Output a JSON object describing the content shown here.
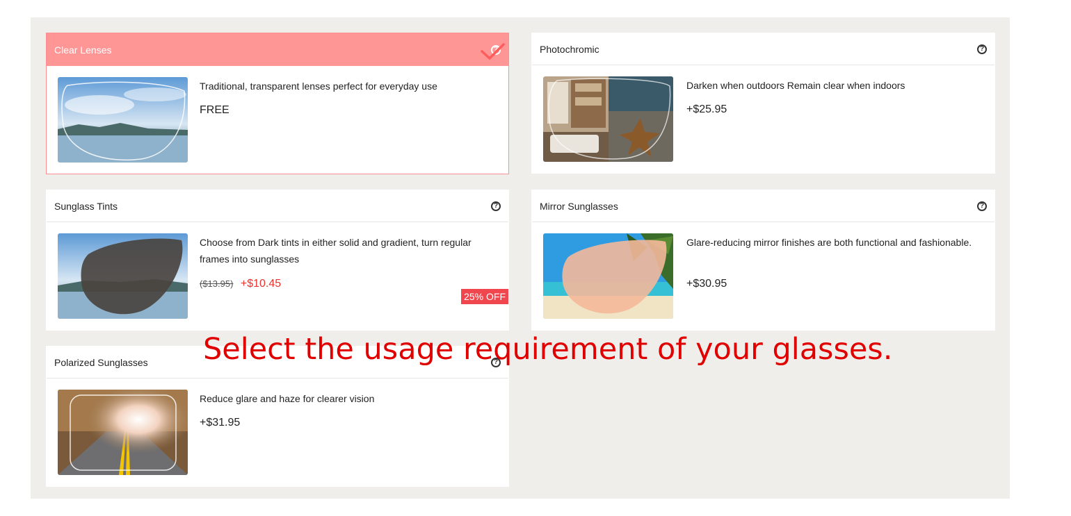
{
  "options": [
    {
      "title": "Clear Lenses",
      "description": "Traditional, transparent lenses perfect for everyday use",
      "price": "FREE",
      "selected": true,
      "icon": "help-icon"
    },
    {
      "title": "Photochromic",
      "description": "Darken when outdoors Remain clear when indoors",
      "price": "+$25.95",
      "icon": "help-icon"
    },
    {
      "title": "Sunglass Tints",
      "description": "Choose from Dark tints in either solid and gradient, turn regular frames into sunglasses",
      "old_price": "($13.95)",
      "price": "+$10.45",
      "badge": "25% OFF",
      "icon": "help-icon"
    },
    {
      "title": "Mirror Sunglasses",
      "description": "Glare-reducing mirror finishes are both functional and fashionable.",
      "price": "+$30.95",
      "icon": "help-icon"
    },
    {
      "title": "Polarized Sunglasses",
      "description": "Reduce glare and haze for clearer vision",
      "price": "+$31.95",
      "icon": "help-icon"
    }
  ],
  "overlay_text": "Select the usage requirement of your glasses.",
  "colors": {
    "selected_header": "#ff9696",
    "selected_border": "#ff8e8e",
    "accent_red": "#e8332f",
    "badge": "#f0474f",
    "overlay": "#e10000",
    "panel_bg": "#efeeeb"
  }
}
